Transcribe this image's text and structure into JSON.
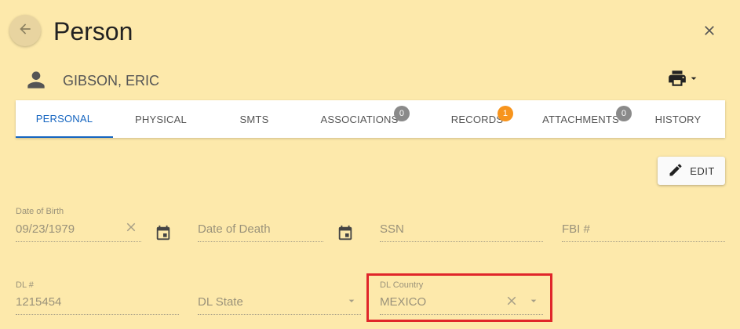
{
  "header": {
    "title": "Person",
    "back_icon": "arrow-left-icon",
    "close_icon": "close-icon"
  },
  "person": {
    "name": "GIBSON, ERIC",
    "icon": "person-icon",
    "print_icon": "printer-icon"
  },
  "tabs": [
    {
      "label": "PERSONAL",
      "active": true
    },
    {
      "label": "PHYSICAL"
    },
    {
      "label": "SMTS"
    },
    {
      "label": "ASSOCIATIONS",
      "badge": "0",
      "badge_color": "#8a8a8a"
    },
    {
      "label": "RECORDS",
      "badge": "1",
      "badge_color": "#f7941d"
    },
    {
      "label": "ATTACHMENTS",
      "badge": "0",
      "badge_color": "#8a8a8a"
    },
    {
      "label": "HISTORY"
    }
  ],
  "actions": {
    "edit_label": "EDIT",
    "edit_icon": "pencil-icon"
  },
  "form": {
    "dob": {
      "label": "Date of Birth",
      "value": "09/23/1979"
    },
    "dod": {
      "placeholder": "Date of Death"
    },
    "ssn": {
      "placeholder": "SSN"
    },
    "fbi": {
      "placeholder": "FBI #"
    },
    "dl_number": {
      "label": "DL #",
      "value": "1215454"
    },
    "dl_state": {
      "placeholder": "DL State"
    },
    "dl_country": {
      "label": "DL Country",
      "value": "MEXICO"
    }
  },
  "colors": {
    "background": "#fde9ab",
    "active_tab": "#1565c0",
    "highlight_border": "#e0262a"
  }
}
